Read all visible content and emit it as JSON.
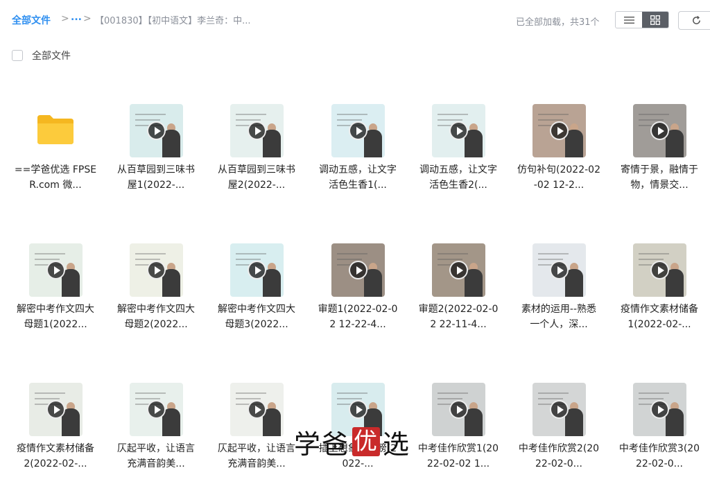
{
  "breadcrumb": {
    "root": "全部文件",
    "sep": ">",
    "ellipsis": "...",
    "current": "【001830】【初中语文】李兰奇：中..."
  },
  "status": "已全部加载，共31个",
  "select_all_label": "全部文件",
  "watermark": {
    "left": "学爸",
    "boxed": "优",
    "right": "选"
  },
  "items": [
    {
      "label": "==学爸优选 FPSER.com 微...",
      "type": "folder",
      "icon": "folder-icon"
    },
    {
      "label": "从百草园到三味书屋1(2022-...",
      "type": "video",
      "bg": "#d9ecec"
    },
    {
      "label": "从百草园到三味书屋2(2022-...",
      "type": "video",
      "bg": "#e6f0ee"
    },
    {
      "label": "调动五感，让文字活色生香1(...",
      "type": "video",
      "bg": "#dbeef2"
    },
    {
      "label": "调动五感，让文字活色生香2(...",
      "type": "video",
      "bg": "#e2efef"
    },
    {
      "label": "仿句补句(2022-02-02 12-2...",
      "type": "video",
      "bg": "#b9a394"
    },
    {
      "label": "寄情于景，融情于物，情景交...",
      "type": "video",
      "bg": "#a09c98"
    },
    {
      "label": "解密中考作文四大母题1(2022...",
      "type": "video",
      "bg": "#e6eee7"
    },
    {
      "label": "解密中考作文四大母题2(2022...",
      "type": "video",
      "bg": "#eef0e6"
    },
    {
      "label": "解密中考作文四大母题3(2022...",
      "type": "video",
      "bg": "#d8eef0"
    },
    {
      "label": "审题1(2022-02-02 12-22-4...",
      "type": "video",
      "bg": "#9c8f84"
    },
    {
      "label": "审题2(2022-02-02 22-11-4...",
      "type": "video",
      "bg": "#a39688"
    },
    {
      "label": "素材的运用--熟悉一个人，深...",
      "type": "video",
      "bg": "#e4e8ec"
    },
    {
      "label": "疫情作文素材储备1(2022-02-...",
      "type": "video",
      "bg": "#d2d0c4"
    },
    {
      "label": "疫情作文素材储备2(2022-02-...",
      "type": "video",
      "bg": "#e8ece6"
    },
    {
      "label": "仄起平收，让语言充满音韵美...",
      "type": "video",
      "bg": "#e8f0ec"
    },
    {
      "label": "仄起平收，让语言充满音韵美...",
      "type": "video",
      "bg": "#eef0ec"
    },
    {
      "label": "插上想象的翅膀(2022-...",
      "type": "video",
      "bg": "#d8ecee"
    },
    {
      "label": "中考佳作欣赏1(2022-02-02 1...",
      "type": "video",
      "bg": "#cfd2d2"
    },
    {
      "label": "中考佳作欣赏2(2022-02-0...",
      "type": "video",
      "bg": "#d4d6d6"
    },
    {
      "label": "中考佳作欣赏3(2022-02-0...",
      "type": "video",
      "bg": "#d1d4d4"
    }
  ]
}
